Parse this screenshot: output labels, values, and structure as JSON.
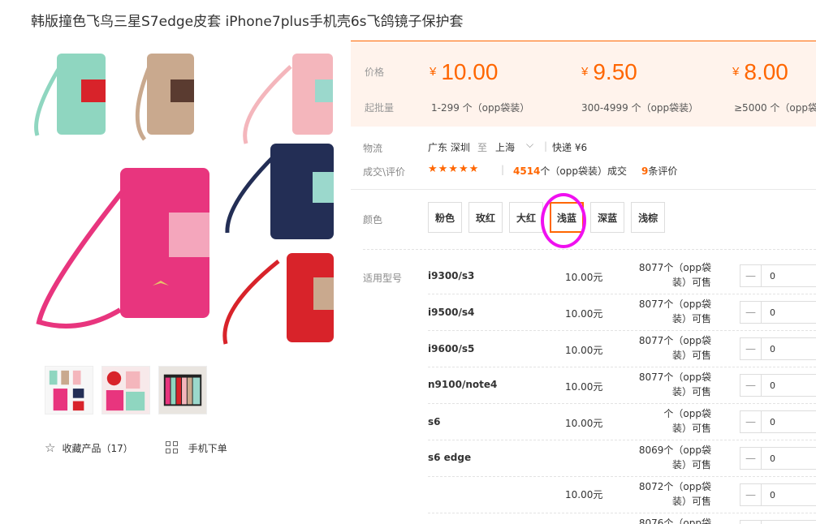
{
  "product": {
    "title": "韩版撞色飞鸟三星S7edge皮套 iPhone7plus手机壳6s飞鸽镜子保护套"
  },
  "gallery": {
    "thumbnail_count": 3
  },
  "actions": {
    "favorite_label": "收藏产品（17）",
    "mobile_order_label": "手机下单"
  },
  "pricing": {
    "price_label": "价格",
    "batch_label": "起批量",
    "currency": "¥",
    "tiers": [
      {
        "price": "10.00",
        "range": "1-299 个（opp袋装）"
      },
      {
        "price": "9.50",
        "range": "300-4999 个（opp袋装）"
      },
      {
        "price": "8.00",
        "range": "≥5000 个（opp袋"
      }
    ]
  },
  "logistics": {
    "label": "物流",
    "origin": "广东 深圳",
    "to": "至",
    "destination": "上海",
    "shipping": "快递 ¥6"
  },
  "reviews": {
    "label": "成交\\评价",
    "stars": "★★★★★",
    "deal_count": "4514",
    "deal_suffix": "个（opp袋装）成交",
    "review_count": "9",
    "review_suffix": "条评价"
  },
  "color": {
    "label": "颜色",
    "options": [
      "粉色",
      "玫红",
      "大红",
      "浅蓝",
      "深蓝",
      "浅棕"
    ],
    "selected": "浅蓝"
  },
  "models": {
    "label": "适用型号",
    "rows": [
      {
        "model": "i9300/s3",
        "price": "10.00元",
        "stock_line1": "8077个（opp袋",
        "stock_line2": "装）可售",
        "qty": "0"
      },
      {
        "model": "i9500/s4",
        "price": "10.00元",
        "stock_line1": "8077个（opp袋",
        "stock_line2": "装）可售",
        "qty": "0"
      },
      {
        "model": "i9600/s5",
        "price": "10.00元",
        "stock_line1": "8077个（opp袋",
        "stock_line2": "装）可售",
        "qty": "0"
      },
      {
        "model": "n9100/note4",
        "price": "10.00元",
        "stock_line1": "8077个（opp袋",
        "stock_line2": "装）可售",
        "qty": "0"
      },
      {
        "model": "s6",
        "price": "10.00元",
        "stock_line1": "个（opp袋",
        "stock_line2": "装）可售",
        "qty": "0"
      },
      {
        "model": "s6 edge",
        "price": "",
        "stock_line1": "8069个（opp袋",
        "stock_line2": "装）可售",
        "qty": "0"
      },
      {
        "model": "",
        "price": "10.00元",
        "stock_line1": "8072个（opp袋",
        "stock_line2": "装）可售",
        "qty": "0"
      },
      {
        "model": "",
        "price": "",
        "stock_line1": "8076个（opp袋",
        "stock_line2": "",
        "qty": ""
      }
    ]
  }
}
